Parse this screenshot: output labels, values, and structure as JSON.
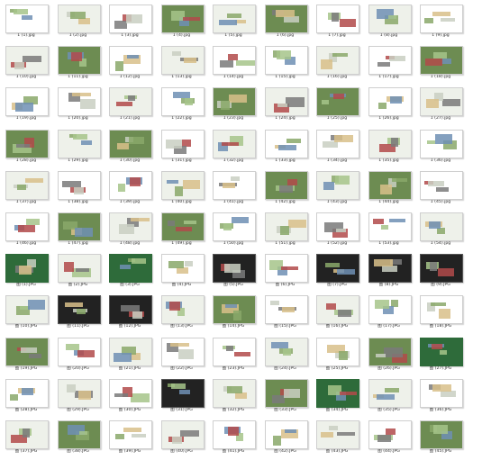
{
  "thumbnails": [
    "1 (1).jpg",
    "1 (2).jpg",
    "1 (3).jpg",
    "1 (4).jpg",
    "1 (5).jpg",
    "1 (6).jpg",
    "1 (7).jpg",
    "1 (8).jpg",
    "1 (9).jpg",
    "1 (10).jpg",
    "1 (11).jpg",
    "1 (12).jpg",
    "1 (13).jpg",
    "1 (14).jpg",
    "1 (15).jpg",
    "1 (16).jpg",
    "1 (17).jpg",
    "1 (18).jpg",
    "1 (19).jpg",
    "1 (20).jpg",
    "1 (21).jpg",
    "1 (22).jpg",
    "1 (23).jpg",
    "1 (24).jpg",
    "1 (25).jpg",
    "1 (26).jpg",
    "1 (27).jpg",
    "1 (28).jpg",
    "1 (29).jpg",
    "1 (30).jpg",
    "1 (31).jpg",
    "1 (32).jpg",
    "1 (33).jpg",
    "1 (34).jpg",
    "1 (35).jpg",
    "1 (36).jpg",
    "1 (37).jpg",
    "1 (38).jpg",
    "1 (39).jpg",
    "1 (40).jpg",
    "1 (41).jpg",
    "1 (42).jpg",
    "1 (43).jpg",
    "1 (44).jpg",
    "1 (45).jpg",
    "1 (46).jpg",
    "1 (47).jpg",
    "1 (48).jpg",
    "1 (49).jpg",
    "1 (50).jpg",
    "1 (51).jpg",
    "1 (52).jpg",
    "1 (53).jpg",
    "1 (54).jpg",
    "图 (1).JPG",
    "图 (2).JPG",
    "图 (3).JPG",
    "图 (4).JPG",
    "图 (5).JPG",
    "图 (6).JPG",
    "图 (7).JPG",
    "图 (8).JPG",
    "图 (9).JPG",
    "图 (10).JPG",
    "图 (11).JPG",
    "图 (12).JPG",
    "图 (13).JPG",
    "图 (14).JPG",
    "图 (15).JPG",
    "图 (16).JPG",
    "图 (17).JPG",
    "图 (18).JPG",
    "图 (19).JPG",
    "图 (20).JPG",
    "图 (21).JPG",
    "图 (22).JPG",
    "图 (23).JPG",
    "图 (24).JPG",
    "图 (25).JPG",
    "图 (26).JPG",
    "图 (27).JPG",
    "图 (28).JPG",
    "图 (29).JPG",
    "图 (30).JPG",
    "图 (31).JPG",
    "图 (32).JPG",
    "图 (33).JPG",
    "图 (34).JPG",
    "图 (35).JPG",
    "图 (36).JPG",
    "图 (37).JPG",
    "图 (38).JPG",
    "图 (39).JPG",
    "图 (40).JPG",
    "图 (41).JPG",
    "图 (42).JPG",
    "图 (43).JPG",
    "图 (44).JPG",
    "图 (45).JPG"
  ],
  "colors": {
    "background": "#ffffff",
    "caption": "#333333",
    "thumb_border": "#cfcfcf",
    "cover_green": "#2e6b3a"
  }
}
